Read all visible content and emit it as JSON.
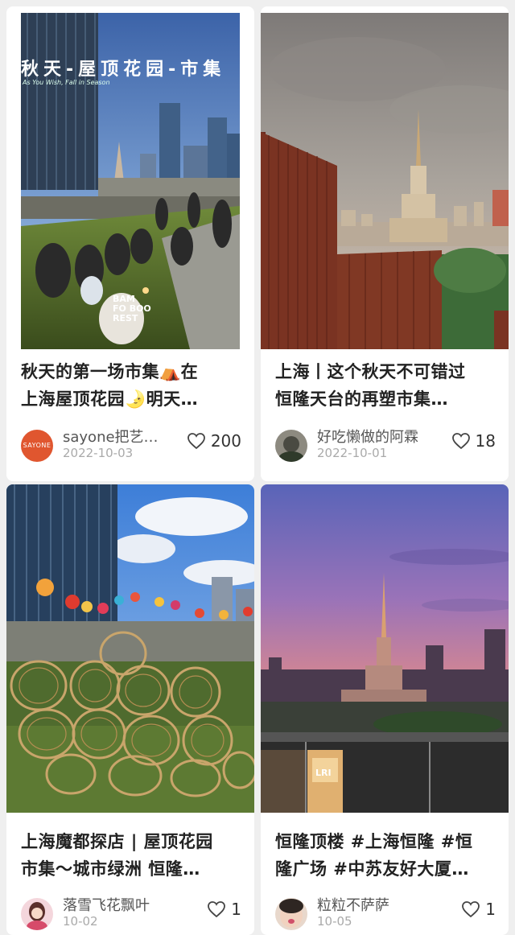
{
  "feed": {
    "cards": [
      {
        "title_lines": [
          "秋天的第一场市集⛺在",
          "上海屋顶花园🌛明天…"
        ],
        "author": "sayone把艺…",
        "date": "2022-10-03",
        "likes": "200",
        "image": {
          "overlay_title": "秋天-屋顶花园-市集",
          "overlay_sub": "As You Wish, Fall in Season",
          "brand_lines": [
            "BAM",
            "FO BOO",
            "REST"
          ],
          "avatar_text": "SAYONE"
        }
      },
      {
        "title_lines": [
          "上海丨这个秋天不可错过",
          "恒隆天台的再塑市集…"
        ],
        "author": "好吃懒做的阿霖",
        "date": "2022-10-01",
        "likes": "18"
      },
      {
        "title_lines": [
          "上海魔都探店 | 屋顶花园",
          "市集～城市绿洲 恒隆…"
        ],
        "author": "落雪飞花飘叶",
        "date": "10-02",
        "likes": "1"
      },
      {
        "title_lines": [
          "恒隆顶楼 #上海恒隆  #恒",
          "隆广场 #中苏友好大厦…"
        ],
        "author": "粒粒不萨萨",
        "date": "10-05",
        "likes": "1",
        "image": {
          "store_sign": "LRI"
        }
      }
    ]
  },
  "colors": {
    "background": "#efefef",
    "card": "#ffffff",
    "title_text": "#222222",
    "meta_text": "#aaaaaa",
    "avatar_sayone": "#e0562f"
  },
  "icons": {
    "like": "heart-outline-icon"
  }
}
